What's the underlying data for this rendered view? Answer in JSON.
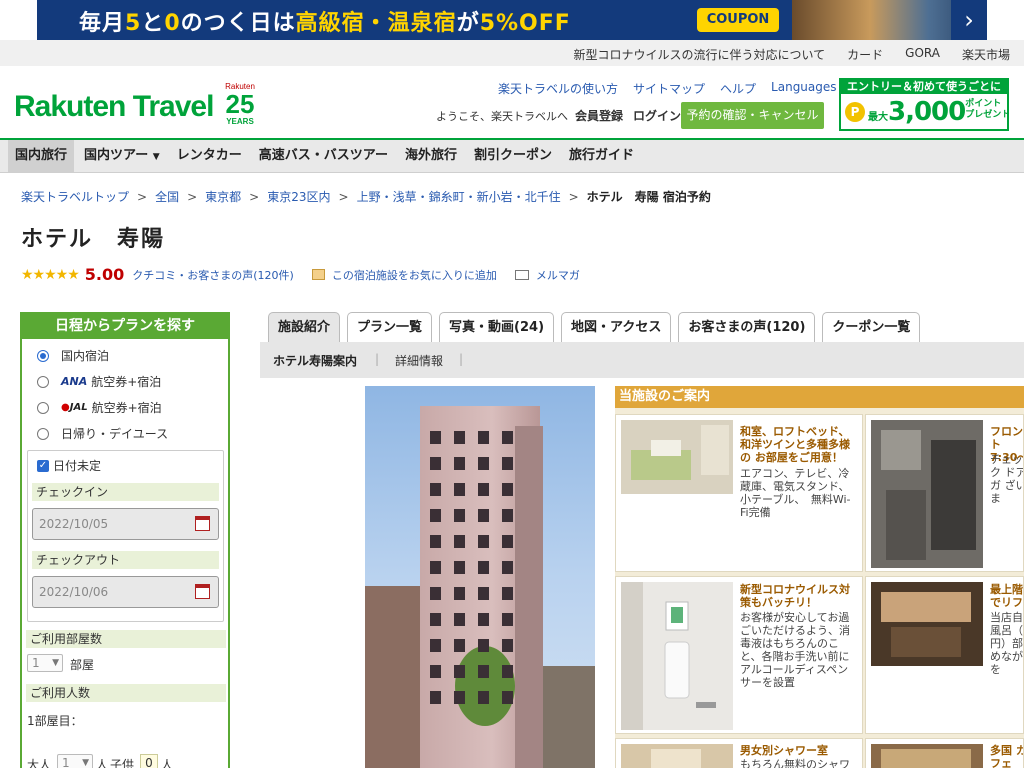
{
  "banner": {
    "text_a": "毎月",
    "text_5": "5",
    "text_b": "と",
    "text_0": "0",
    "text_c": "のつく日は",
    "text_d": "高級宿・温泉宿",
    "text_e": "が",
    "text_f": "5%OFF",
    "coupon": "COUPON",
    "arrow": "›"
  },
  "util_links": [
    "新型コロナウイルスの流行に伴う対応について",
    "カード",
    "GORA",
    "楽天市場"
  ],
  "header": {
    "logo": "Rakuten Travel",
    "anniv_small": "Rakuten",
    "anniv_num": "25",
    "anniv_years": "YEARS",
    "links": [
      "楽天トラベルの使い方",
      "サイトマップ",
      "ヘルプ"
    ],
    "languages": "Languages",
    "welcome": "ようこそ、楽天トラベルへ",
    "member": "会員登録",
    "login": "ログイン",
    "confirm": "予約の確認・キャンセル",
    "promo_top": "エントリー＆初めて使うごとに",
    "promo_coin": "P",
    "promo_max": "最大",
    "promo_amount": "3,000",
    "promo_point": "ポイント",
    "promo_present": "プレゼント"
  },
  "nav": [
    "国内旅行",
    "国内ツアー",
    "レンタカー",
    "高速バス・バスツアー",
    "海外旅行",
    "割引クーポン",
    "旅行ガイド"
  ],
  "breadcrumb": [
    "楽天トラベルトップ",
    "全国",
    "東京都",
    "東京23区内",
    "上野・浅草・錦糸町・新小岩・北千住"
  ],
  "breadcrumb_current": "ホテル　寿陽 宿泊予約",
  "hotel_name": "ホテル　寿陽",
  "rating": {
    "stars": "★★★★★",
    "score": "5.00",
    "review": "クチコミ・お客さまの声(120件)",
    "fav": "この宿泊施設をお気に入りに追加",
    "mail": "メルマガ"
  },
  "search": {
    "title": "日程からプランを探す",
    "options": [
      "国内宿泊",
      "航空券+宿泊",
      "航空券+宿泊",
      "日帰り・デイユース"
    ],
    "ana": "ANA",
    "jal_dot": "●",
    "jal": "JAL",
    "date_undecided": "日付未定",
    "checkin_label": "チェックイン",
    "checkin_value": "2022/10/05",
    "checkout_label": "チェックアウト",
    "checkout_value": "2022/10/06",
    "rooms_label": "ご利用部屋数",
    "rooms_value": "1",
    "rooms_unit": "部屋",
    "people_label": "ご利用人数",
    "room1": "1部屋目：",
    "adult_label": "大人",
    "adult_value": "1",
    "adult_unit": "人",
    "child_label": "子供",
    "child_value": "0",
    "child_unit": "人"
  },
  "tabs": [
    "施設紹介",
    "プラン一覧",
    "写真・動画(24)",
    "地図・アクセス",
    "お客さまの声(120)",
    "クーポン一覧"
  ],
  "subtabs": [
    "ホテル寿陽案内",
    "詳細情報"
  ],
  "guide": {
    "title": "当施設のご案内",
    "cards": [
      {
        "title": "和室、ロフトベッド、和洋ツインと多種多様の お部屋をご用意！",
        "desc": "エアコン、テレビ、冷蔵庫、電気スタンド、小テーブル、　無料Wi-Fi完備"
      },
      {
        "title": "フロント 7:30〜",
        "desc": "チェック ドアガ ざいま"
      },
      {
        "title": "新型コロナウイルス対策もバッチリ！",
        "desc": "お客様が安心してお過ごいただけるよう、消毒液はもちろんのこと、各階お手洗い前にアルコールディスペンサーを設置"
      },
      {
        "title": "最上階 でリフ",
        "desc": "当店自 風呂（ 円）部 めなが を"
      },
      {
        "title": "男女別シャワー室",
        "desc": "もちろん無料のシャワ"
      },
      {
        "title": "多国 カフェ",
        "desc": ""
      }
    ]
  }
}
